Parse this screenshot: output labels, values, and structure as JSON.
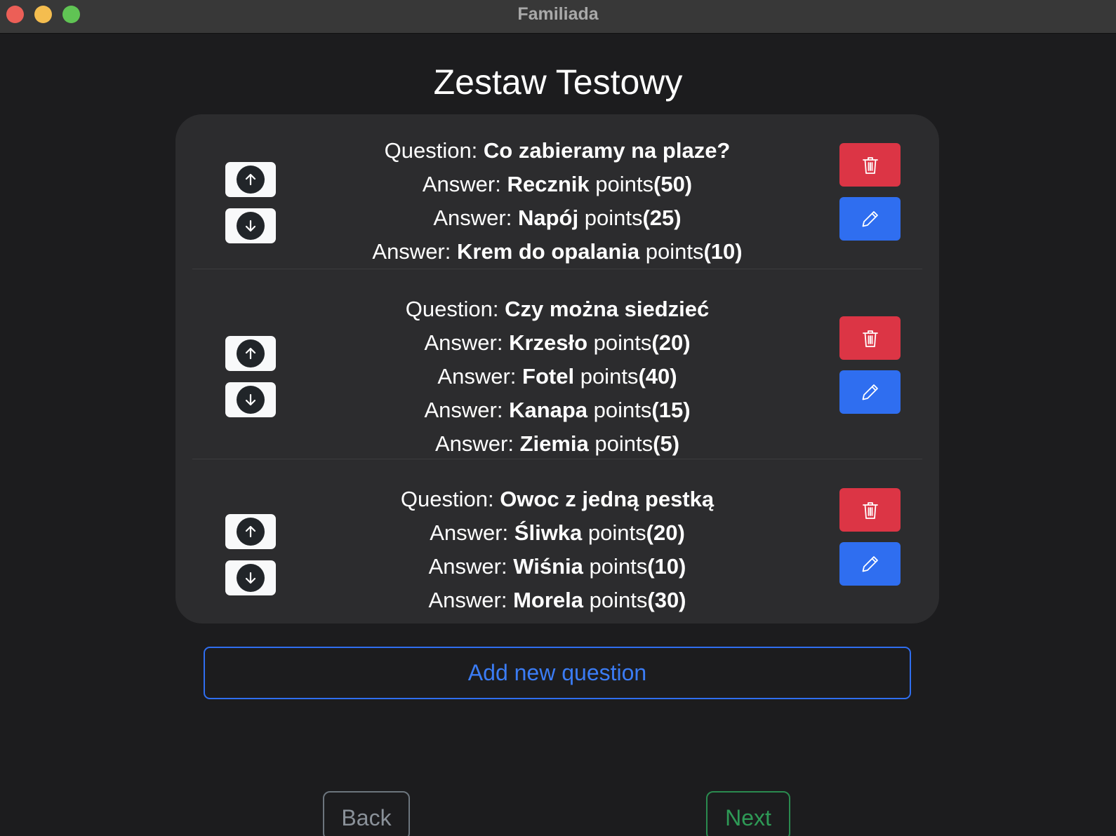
{
  "window": {
    "title": "Familiada"
  },
  "page": {
    "title": "Zestaw Testowy"
  },
  "labels": {
    "question": "Question: ",
    "answer": "Answer: ",
    "points": "points"
  },
  "questions": [
    {
      "text": "Co zabieramy na plaze?",
      "answers": [
        {
          "text": "Recznik",
          "points": "(50)"
        },
        {
          "text": "Napój",
          "points": "(25)"
        },
        {
          "text": "Krem do opalania",
          "points": "(10)"
        }
      ]
    },
    {
      "text": "Czy można siedzieć",
      "answers": [
        {
          "text": "Krzesło",
          "points": "(20)"
        },
        {
          "text": "Fotel",
          "points": "(40)"
        },
        {
          "text": "Kanapa",
          "points": "(15)"
        },
        {
          "text": "Ziemia",
          "points": "(5)"
        }
      ]
    },
    {
      "text": "Owoc z jedną pestką",
      "answers": [
        {
          "text": "Śliwka",
          "points": "(20)"
        },
        {
          "text": "Wiśnia",
          "points": "(10)"
        },
        {
          "text": "Morela",
          "points": "(30)"
        }
      ]
    }
  ],
  "buttons": {
    "add_question": "Add new question",
    "back": "Back",
    "next": "Next"
  },
  "icons": {
    "move_up": "arrow-up-circle-icon",
    "move_down": "arrow-down-circle-icon",
    "delete": "trash-icon",
    "edit": "pencil-icon"
  },
  "colors": {
    "background": "#1c1c1e",
    "panel": "#2c2c2e",
    "delete": "#dc3545",
    "edit": "#2f6ef0",
    "accent": "#3b7cf5",
    "next": "#2e9a56",
    "back": "#6c757d"
  }
}
